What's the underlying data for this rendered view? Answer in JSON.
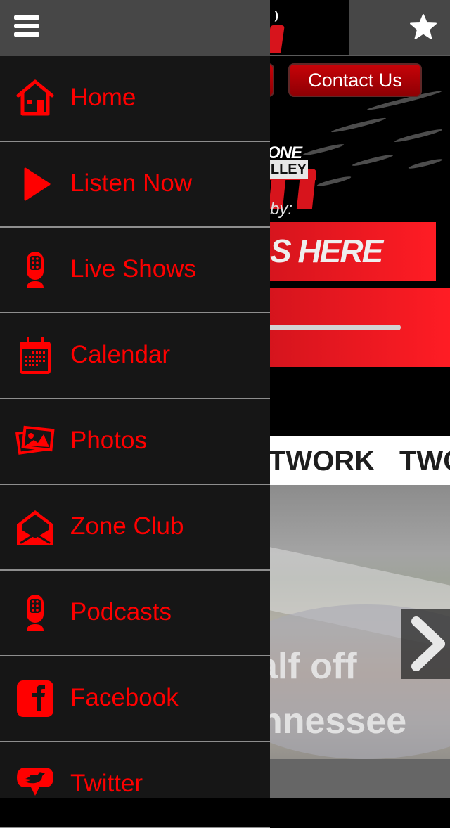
{
  "app": {
    "accent_color": "#ff0000",
    "drawer_bg": "#161616",
    "header_bg": "#474747"
  },
  "header": {
    "menu_icon": "hamburger-icon",
    "favorite_icon": "star-icon"
  },
  "drawer": {
    "items": [
      {
        "label": "Home",
        "icon": "home-icon"
      },
      {
        "label": "Listen Now",
        "icon": "play-icon"
      },
      {
        "label": "Live Shows",
        "icon": "microphone-icon"
      },
      {
        "label": "Calendar",
        "icon": "calendar-icon"
      },
      {
        "label": "Photos",
        "icon": "photos-icon"
      },
      {
        "label": "Zone Club",
        "icon": "open-envelope-icon"
      },
      {
        "label": "Podcasts",
        "icon": "microphone-icon"
      },
      {
        "label": "Facebook",
        "icon": "facebook-icon"
      },
      {
        "label": "Twitter",
        "icon": "twitter-icon"
      }
    ]
  },
  "main": {
    "contact_button": "Contact Us",
    "logo": {
      "zone_text": "ONE",
      "valley_text": "LLEY"
    },
    "sponsor": {
      "by_label": "by:",
      "banner_text": "S HERE"
    },
    "player": {
      "progress_fraction": 0.85
    },
    "network_strip": {
      "items": [
        "TWORK",
        "TWO"
      ]
    },
    "slider": {
      "caption_line1": "alf off",
      "caption_line2": "nnessee",
      "next_icon": "chevron-right-icon"
    }
  }
}
